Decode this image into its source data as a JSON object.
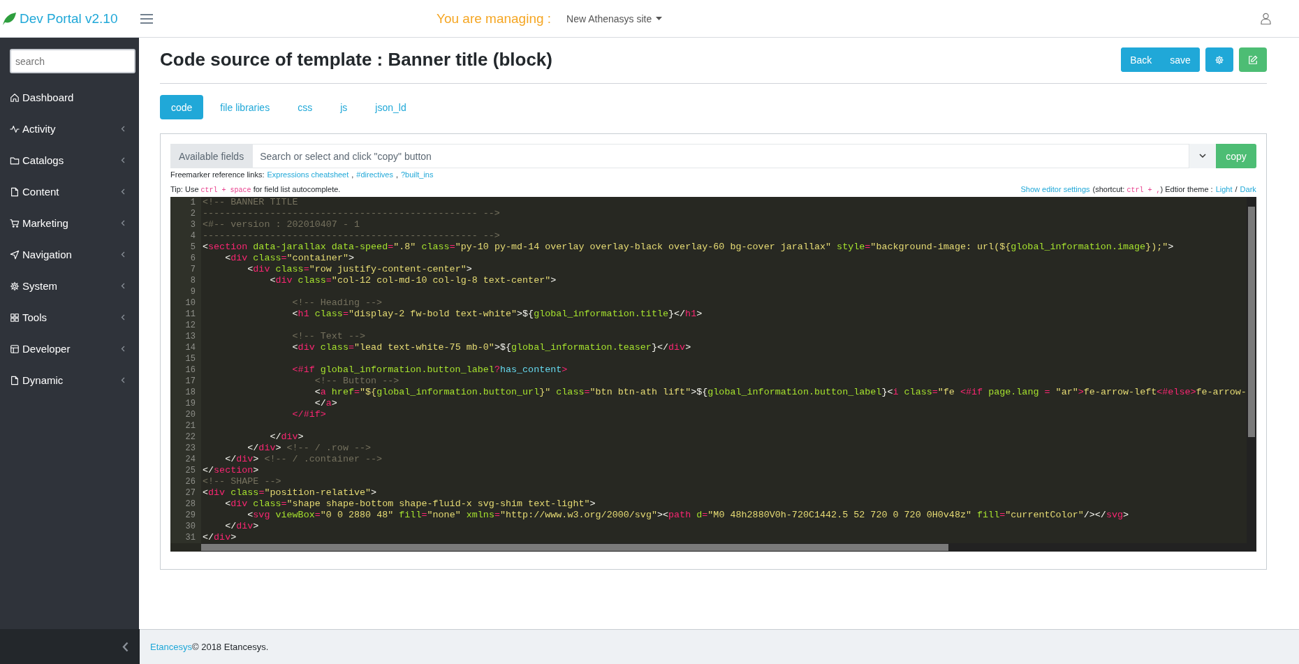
{
  "header": {
    "brand": "Dev Portal v2.10",
    "managing_label": "You are managing :",
    "site": "New Athenasys site"
  },
  "sidebar": {
    "search_placeholder": "search",
    "items": [
      {
        "label": "Dashboard",
        "expandable": false
      },
      {
        "label": "Activity",
        "expandable": true
      },
      {
        "label": "Catalogs",
        "expandable": true
      },
      {
        "label": "Content",
        "expandable": true
      },
      {
        "label": "Marketing",
        "expandable": true
      },
      {
        "label": "Navigation",
        "expandable": true
      },
      {
        "label": "System",
        "expandable": true
      },
      {
        "label": "Tools",
        "expandable": true
      },
      {
        "label": "Developer",
        "expandable": true
      },
      {
        "label": "Dynamic",
        "expandable": true
      }
    ]
  },
  "page": {
    "title": "Code source of template : Banner title (block)",
    "actions": [
      "Back",
      "save"
    ]
  },
  "tabs": [
    {
      "label": "code",
      "selected": true
    },
    {
      "label": "file libraries",
      "selected": false
    },
    {
      "label": "css",
      "selected": false
    },
    {
      "label": "js",
      "selected": false
    },
    {
      "label": "json_ld",
      "selected": false
    }
  ],
  "fields": {
    "addon": "Available fields",
    "placeholder": "Search or select and click \"copy\" button",
    "copy": "copy"
  },
  "reference": [
    {
      "kind": "text",
      "text": "Freemarker reference links:"
    },
    {
      "kind": "link",
      "text": "Expressions cheatsheet"
    },
    {
      "kind": "text",
      "text": ","
    },
    {
      "kind": "link",
      "text": "#directives"
    },
    {
      "kind": "text",
      "text": ","
    },
    {
      "kind": "link",
      "text": "?built_ins"
    }
  ],
  "tip": [
    {
      "kind": "text",
      "text": "Tip: Use "
    },
    {
      "kind": "code",
      "text": "ctrl + space"
    },
    {
      "kind": "text",
      "text": " for field list autocomplete."
    }
  ],
  "editor_settings": [
    {
      "kind": "link",
      "text": "Show editor settings"
    },
    {
      "kind": "text",
      "parts": [
        {
          "kind": "text",
          "text": "(shortcut: "
        },
        {
          "kind": "code",
          "text": "ctrl + ,"
        },
        {
          "kind": "text",
          "text": ") Edtior theme :"
        }
      ]
    },
    {
      "kind": "link",
      "text": "Light"
    },
    {
      "kind": "text",
      "text": "/"
    },
    {
      "kind": "link",
      "text": "Dark"
    }
  ],
  "editor": {
    "lines": [
      {
        "number": "1",
        "tokens": [
          {
            "kind": "comment",
            "text": "<!-- BANNER TITLE"
          }
        ]
      },
      {
        "number": "2",
        "tokens": [
          {
            "kind": "comment",
            "text": "------------------------------------------------- -->"
          }
        ]
      },
      {
        "number": "3",
        "tokens": [
          {
            "kind": "comment",
            "text": "<#-- version : 202010407 - 1"
          }
        ]
      },
      {
        "number": "4",
        "tokens": [
          {
            "kind": "comment",
            "text": "------------------------------------------------- -->"
          }
        ]
      },
      {
        "number": "5",
        "tokens": [
          {
            "kind": "plain",
            "text": "<"
          },
          {
            "kind": "tag",
            "text": "section"
          },
          {
            "kind": "attr",
            "text": " data-jarallax data-speed"
          },
          {
            "kind": "tag",
            "text": "="
          },
          {
            "kind": "string",
            "text": "\".8\""
          },
          {
            "kind": "attr",
            "text": " class"
          },
          {
            "kind": "tag",
            "text": "="
          },
          {
            "kind": "string",
            "text": "\"py-10 py-md-14 overlay overlay-black overlay-60 bg-cover jarallax\""
          },
          {
            "kind": "attr",
            "text": " style"
          },
          {
            "kind": "tag",
            "text": "="
          },
          {
            "kind": "string",
            "text": "\"background-image: url(${"
          },
          {
            "kind": "attr",
            "text": "global_information.image"
          },
          {
            "kind": "string",
            "text": "});\""
          },
          {
            "kind": "plain",
            "text": ">"
          }
        ]
      },
      {
        "number": "6",
        "tokens": [
          {
            "kind": "plain",
            "text": "    <"
          },
          {
            "kind": "tag",
            "text": "div"
          },
          {
            "kind": "attr",
            "text": " class"
          },
          {
            "kind": "tag",
            "text": "="
          },
          {
            "kind": "string",
            "text": "\"container\""
          },
          {
            "kind": "plain",
            "text": ">"
          }
        ]
      },
      {
        "number": "7",
        "tokens": [
          {
            "kind": "plain",
            "text": "        <"
          },
          {
            "kind": "tag",
            "text": "div"
          },
          {
            "kind": "attr",
            "text": " class"
          },
          {
            "kind": "tag",
            "text": "="
          },
          {
            "kind": "string",
            "text": "\"row justify-content-center\""
          },
          {
            "kind": "plain",
            "text": ">"
          }
        ]
      },
      {
        "number": "8",
        "tokens": [
          {
            "kind": "plain",
            "text": "            <"
          },
          {
            "kind": "tag",
            "text": "div"
          },
          {
            "kind": "attr",
            "text": " class"
          },
          {
            "kind": "tag",
            "text": "="
          },
          {
            "kind": "string",
            "text": "\"col-12 col-md-10 col-lg-8 text-center\""
          },
          {
            "kind": "plain",
            "text": ">"
          }
        ]
      },
      {
        "number": "9"
      },
      {
        "number": "10",
        "tokens": [
          {
            "kind": "comment",
            "text": "                <!-- Heading -->"
          }
        ]
      },
      {
        "number": "11",
        "tokens": [
          {
            "kind": "plain",
            "text": "                <"
          },
          {
            "kind": "tag",
            "text": "h1"
          },
          {
            "kind": "attr",
            "text": " class"
          },
          {
            "kind": "tag",
            "text": "="
          },
          {
            "kind": "string",
            "text": "\"display-2 fw-bold text-white\""
          },
          {
            "kind": "plain",
            "text": ">${"
          },
          {
            "kind": "attr",
            "text": "global_information.title"
          },
          {
            "kind": "plain",
            "text": "}</"
          },
          {
            "kind": "tag",
            "text": "h1"
          },
          {
            "kind": "plain",
            "text": ">"
          }
        ]
      },
      {
        "number": "12"
      },
      {
        "number": "13",
        "tokens": [
          {
            "kind": "comment",
            "text": "                <!-- Text -->"
          }
        ]
      },
      {
        "number": "14",
        "tokens": [
          {
            "kind": "plain",
            "text": "                <"
          },
          {
            "kind": "tag",
            "text": "div"
          },
          {
            "kind": "attr",
            "text": " class"
          },
          {
            "kind": "tag",
            "text": "="
          },
          {
            "kind": "string",
            "text": "\"lead text-white-75 mb-0\""
          },
          {
            "kind": "plain",
            "text": ">${"
          },
          {
            "kind": "attr",
            "text": "global_information.teaser"
          },
          {
            "kind": "plain",
            "text": "}</"
          },
          {
            "kind": "tag",
            "text": "div"
          },
          {
            "kind": "plain",
            "text": ">"
          }
        ]
      },
      {
        "number": "15"
      },
      {
        "number": "16",
        "tokens": [
          {
            "kind": "tag",
            "text": "                <#if"
          },
          {
            "kind": "attr",
            "text": " global_information.button_label"
          },
          {
            "kind": "tag",
            "text": "?"
          },
          {
            "kind": "builtin",
            "text": "has_content"
          },
          {
            "kind": "tag",
            "text": ">"
          }
        ]
      },
      {
        "number": "17",
        "tokens": [
          {
            "kind": "comment",
            "text": "                    <!-- Button -->"
          }
        ]
      },
      {
        "number": "18",
        "tokens": [
          {
            "kind": "plain",
            "text": "                    <"
          },
          {
            "kind": "tag",
            "text": "a"
          },
          {
            "kind": "attr",
            "text": " href"
          },
          {
            "kind": "tag",
            "text": "="
          },
          {
            "kind": "string",
            "text": "\"${"
          },
          {
            "kind": "attr",
            "text": "global_information.button_url"
          },
          {
            "kind": "string",
            "text": "}\""
          },
          {
            "kind": "attr",
            "text": " class"
          },
          {
            "kind": "tag",
            "text": "="
          },
          {
            "kind": "string",
            "text": "\"btn btn-ath lift\""
          },
          {
            "kind": "plain",
            "text": ">${"
          },
          {
            "kind": "attr",
            "text": "global_information.button_label"
          },
          {
            "kind": "plain",
            "text": "}<"
          },
          {
            "kind": "tag",
            "text": "i"
          },
          {
            "kind": "attr",
            "text": " class"
          },
          {
            "kind": "tag",
            "text": "="
          },
          {
            "kind": "string",
            "text": "\"fe "
          },
          {
            "kind": "tag",
            "text": "<#if"
          },
          {
            "kind": "attr",
            "text": " page.lang "
          },
          {
            "kind": "tag",
            "text": "="
          },
          {
            "kind": "string",
            "text": " \"ar\""
          },
          {
            "kind": "tag",
            "text": ">"
          },
          {
            "kind": "string",
            "text": "fe-arrow-left"
          },
          {
            "kind": "tag",
            "text": "<#else>"
          },
          {
            "kind": "string",
            "text": "fe-arrow-"
          }
        ]
      },
      {
        "number": "19",
        "tokens": [
          {
            "kind": "plain",
            "text": "                    </"
          },
          {
            "kind": "tag",
            "text": "a"
          },
          {
            "kind": "plain",
            "text": ">"
          }
        ]
      },
      {
        "number": "20",
        "tokens": [
          {
            "kind": "tag",
            "text": "                </#if>"
          }
        ]
      },
      {
        "number": "21"
      },
      {
        "number": "22",
        "tokens": [
          {
            "kind": "plain",
            "text": "            </"
          },
          {
            "kind": "tag",
            "text": "div"
          },
          {
            "kind": "plain",
            "text": ">"
          }
        ]
      },
      {
        "number": "23",
        "tokens": [
          {
            "kind": "plain",
            "text": "        </"
          },
          {
            "kind": "tag",
            "text": "div"
          },
          {
            "kind": "plain",
            "text": "> "
          },
          {
            "kind": "comment",
            "text": "<!-- / .row -->"
          }
        ]
      },
      {
        "number": "24",
        "tokens": [
          {
            "kind": "plain",
            "text": "    </"
          },
          {
            "kind": "tag",
            "text": "div"
          },
          {
            "kind": "plain",
            "text": "> "
          },
          {
            "kind": "comment",
            "text": "<!-- / .container -->"
          }
        ]
      },
      {
        "number": "25",
        "tokens": [
          {
            "kind": "plain",
            "text": "</"
          },
          {
            "kind": "tag",
            "text": "section"
          },
          {
            "kind": "plain",
            "text": ">"
          }
        ]
      },
      {
        "number": "26",
        "tokens": [
          {
            "kind": "comment",
            "text": "<!-- SHAPE -->"
          }
        ]
      },
      {
        "number": "27",
        "tokens": [
          {
            "kind": "plain",
            "text": "<"
          },
          {
            "kind": "tag",
            "text": "div"
          },
          {
            "kind": "attr",
            "text": " class"
          },
          {
            "kind": "tag",
            "text": "="
          },
          {
            "kind": "string",
            "text": "\"position-relative\""
          },
          {
            "kind": "plain",
            "text": ">"
          }
        ]
      },
      {
        "number": "28",
        "tokens": [
          {
            "kind": "plain",
            "text": "    <"
          },
          {
            "kind": "tag",
            "text": "div"
          },
          {
            "kind": "attr",
            "text": " class"
          },
          {
            "kind": "tag",
            "text": "="
          },
          {
            "kind": "string",
            "text": "\"shape shape-bottom shape-fluid-x svg-shim text-light\""
          },
          {
            "kind": "plain",
            "text": ">"
          }
        ]
      },
      {
        "number": "29",
        "tokens": [
          {
            "kind": "plain",
            "text": "        <"
          },
          {
            "kind": "tag",
            "text": "svg"
          },
          {
            "kind": "attr",
            "text": " viewBox"
          },
          {
            "kind": "tag",
            "text": "="
          },
          {
            "kind": "string",
            "text": "\"0 0 2880 48\""
          },
          {
            "kind": "attr",
            "text": " fill"
          },
          {
            "kind": "tag",
            "text": "="
          },
          {
            "kind": "string",
            "text": "\"none\""
          },
          {
            "kind": "attr",
            "text": " xmlns"
          },
          {
            "kind": "tag",
            "text": "="
          },
          {
            "kind": "string",
            "text": "\"http://www.w3.org/2000/svg\""
          },
          {
            "kind": "plain",
            "text": "><"
          },
          {
            "kind": "tag",
            "text": "path"
          },
          {
            "kind": "attr",
            "text": " d"
          },
          {
            "kind": "tag",
            "text": "="
          },
          {
            "kind": "string",
            "text": "\"M0 48h2880V0h-720C1442.5 52 720 0 720 0H0v48z\""
          },
          {
            "kind": "attr",
            "text": " fill"
          },
          {
            "kind": "tag",
            "text": "="
          },
          {
            "kind": "string",
            "text": "\"currentColor\""
          },
          {
            "kind": "plain",
            "text": "/></"
          },
          {
            "kind": "tag",
            "text": "svg"
          },
          {
            "kind": "plain",
            "text": ">"
          }
        ]
      },
      {
        "number": "30",
        "tokens": [
          {
            "kind": "plain",
            "text": "    </"
          },
          {
            "kind": "tag",
            "text": "div"
          },
          {
            "kind": "plain",
            "text": ">"
          }
        ]
      },
      {
        "number": "31",
        "tokens": [
          {
            "kind": "plain",
            "text": "</"
          },
          {
            "kind": "tag",
            "text": "div"
          },
          {
            "kind": "plain",
            "text": ">"
          }
        ]
      }
    ]
  },
  "footer": {
    "company_link": "Etancesys",
    "copyright": "© 2018 Etancesys."
  }
}
